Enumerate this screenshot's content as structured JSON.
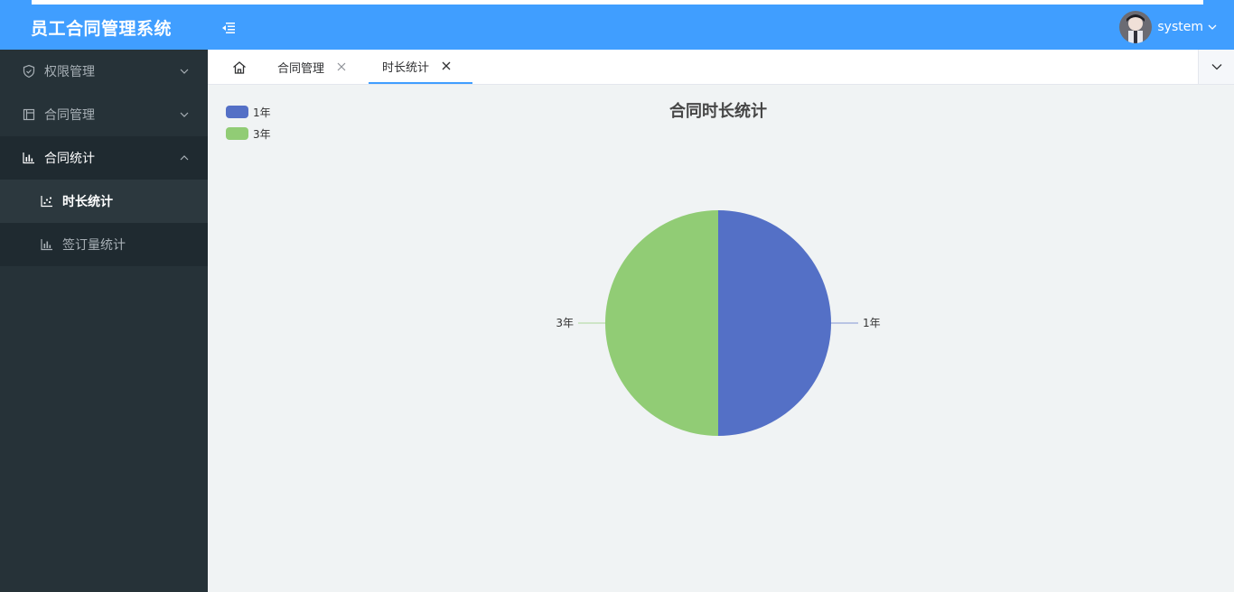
{
  "header": {
    "app_title": "员工合同管理系统",
    "username": "system",
    "colors": {
      "primary": "#409eff"
    }
  },
  "sidebar": {
    "items": [
      {
        "label": "权限管理",
        "icon": "shield-icon"
      },
      {
        "label": "合同管理",
        "icon": "contract-icon"
      },
      {
        "label": "合同统计",
        "icon": "bar-chart-icon",
        "open": true,
        "children": [
          {
            "label": "时长统计",
            "icon": "scatter-chart-icon",
            "active": true
          },
          {
            "label": "签订量统计",
            "icon": "bar-chart-icon"
          }
        ]
      }
    ]
  },
  "tabs": [
    {
      "label": "合同管理"
    },
    {
      "label": "时长统计",
      "active": true
    }
  ],
  "chart_data": {
    "type": "pie",
    "title": "合同时长统计",
    "categories": [
      "1年",
      "3年"
    ],
    "values": [
      1,
      1
    ],
    "colors": [
      "#5470c6",
      "#91cc75"
    ],
    "legend_position": "top-left"
  }
}
